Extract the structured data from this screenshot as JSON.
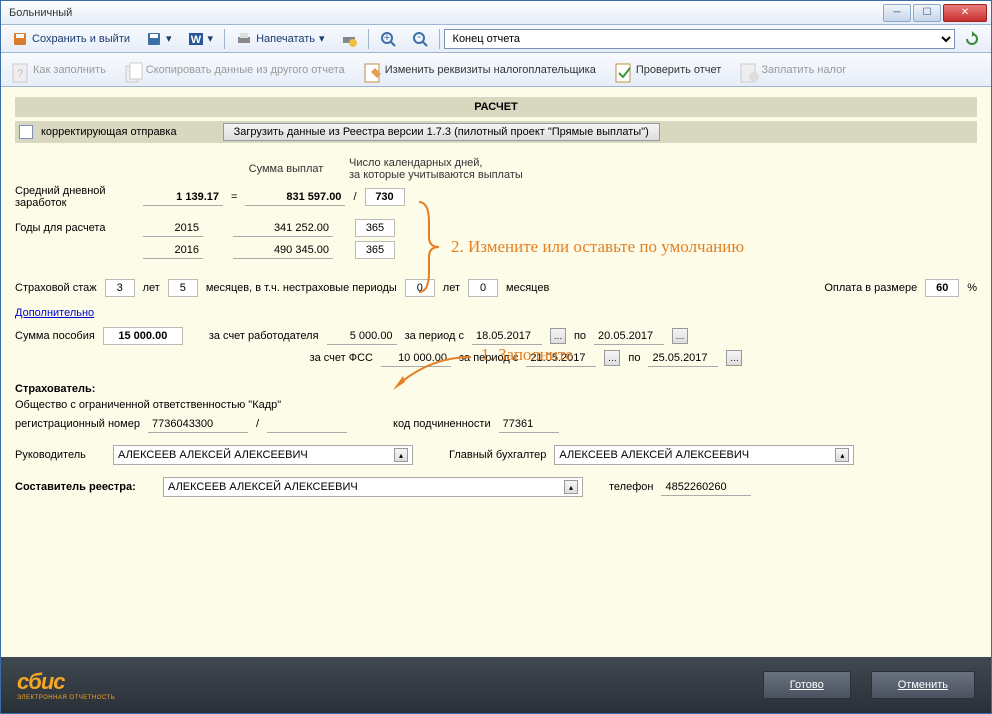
{
  "window": {
    "title": "Больничный"
  },
  "toolbar": {
    "save_exit": "Сохранить и выйти",
    "print": "Напечатать",
    "nav_select": "Конец отчета"
  },
  "toolbar2": {
    "howto": "Как заполнить",
    "copy": "Скопировать данные из другого отчета",
    "change": "Изменить реквизиты налогоплательщика",
    "check": "Проверить отчет",
    "pay": "Заплатить налог"
  },
  "section": {
    "title": "РАСЧЕТ"
  },
  "correction_label": "корректирующая отправка",
  "load_registry_btn": "Загрузить данные из Реестра версии 1.7.3 (пилотный проект \"Прямые выплаты\")",
  "headers": {
    "sum": "Сумма выплат",
    "days": "Число календарных дней,\nза которые учитываются выплаты"
  },
  "avg_daily_label": "Средний дневной заработок",
  "avg_daily": "1 139.17",
  "total_sum": "831 597.00",
  "total_days": "730",
  "years_label": "Годы для расчета",
  "year1": "2015",
  "sum1": "341 252.00",
  "days1": "365",
  "year2": "2016",
  "sum2": "490 345.00",
  "days2": "365",
  "ins_label": "Страховой стаж",
  "ins_years": "3",
  "ins_months": "5",
  "ins_years_w": "лет",
  "ins_months_w": "месяцев, в т.ч. нестраховые периоды",
  "nonins_years": "0",
  "nonins_months": "0",
  "nonins_years_w": "лет",
  "nonins_months_w": "месяцев",
  "pay_rate_label": "Оплата в размере",
  "pay_rate": "60",
  "pay_rate_unit": "%",
  "more_link": "Дополнительно",
  "benefit_label": "Сумма пособия",
  "benefit": "15 000.00",
  "employer_label": "за счет работодателя",
  "employer": "5 000.00",
  "period_from": "за период с",
  "period_to": "по",
  "emp_from": "18.05.2017",
  "emp_to": "20.05.2017",
  "fss_label": "за счет ФСС",
  "fss": "10 000.00",
  "fss_from": "21.05.2017",
  "fss_to": "25.05.2017",
  "insurer_label": "Страхователь:",
  "insurer_name": "Общество с ограниченной ответственностью \"Кадр\"",
  "reg_label": "регистрационный номер",
  "reg_num": "7736043300",
  "reg_sep": "/",
  "sub_label": "код подчиненности",
  "sub_code": "77361",
  "head_label": "Руководитель",
  "head": "АЛЕКСЕЕВ АЛЕКСЕЙ АЛЕКСЕЕВИЧ",
  "acc_label": "Главный бухгалтер",
  "acc": "АЛЕКСЕЕВ АЛЕКСЕЙ АЛЕКСЕЕВИЧ",
  "compiler_label": "Составитель реестра:",
  "compiler": "АЛЕКСЕЕВ АЛЕКСЕЙ АЛЕКСЕЕВИЧ",
  "phone_label": "телефон",
  "phone": "4852260260",
  "logo": "сбис",
  "logo_sub": "ЭЛЕКТРОННАЯ ОТЧЕТНОСТЬ",
  "ok_btn": "Готово",
  "cancel_btn": "Отменить",
  "annot1": "1. Заполните",
  "annot2": "2. Измените или оставьте по умолчанию"
}
